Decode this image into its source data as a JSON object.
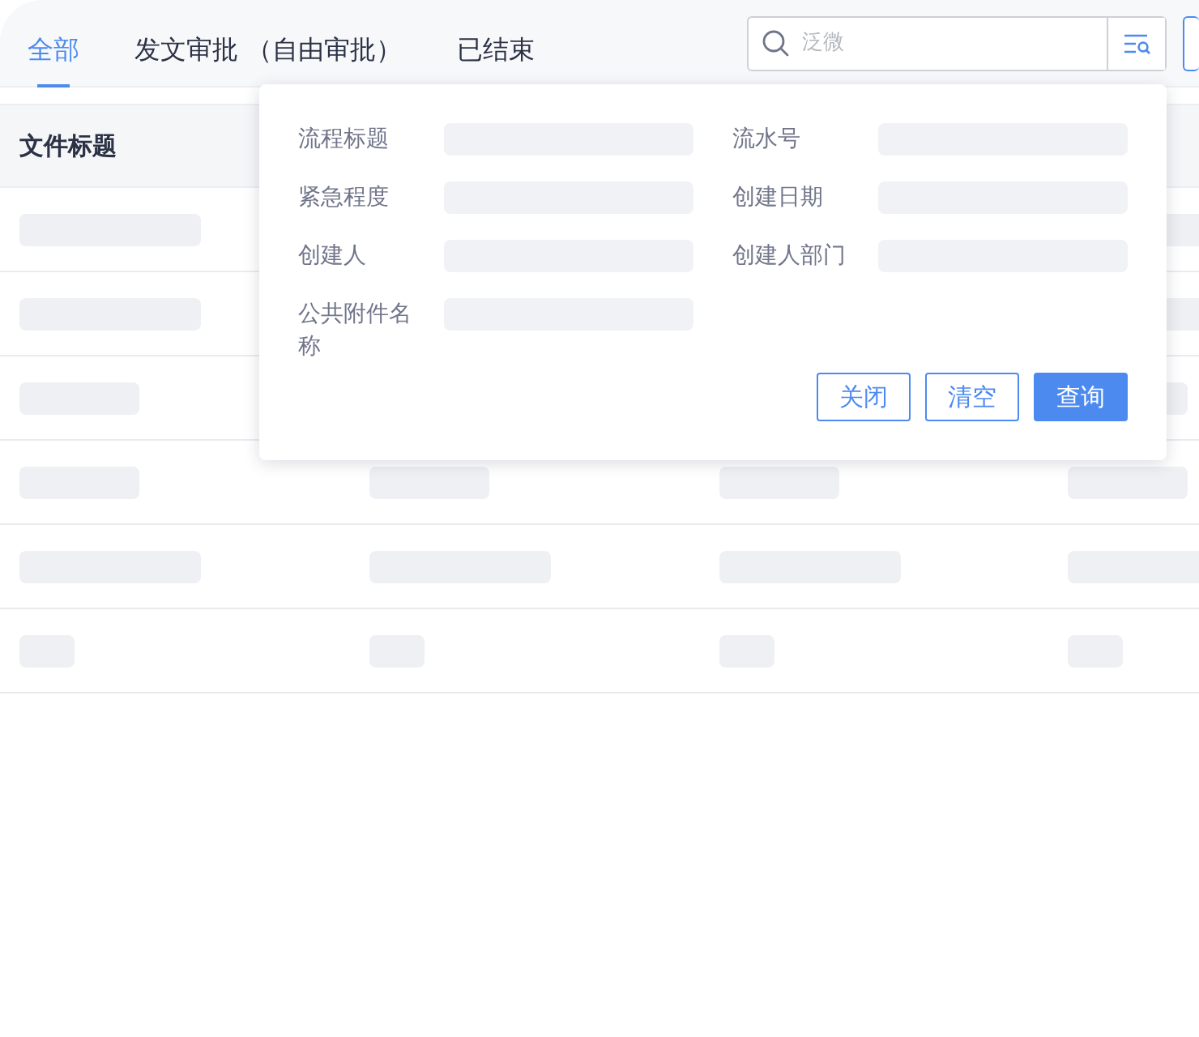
{
  "tabs": [
    {
      "label": "全部",
      "selected": true
    },
    {
      "label": "发文审批 （自由审批）",
      "selected": false
    },
    {
      "label": "已结束",
      "selected": false
    }
  ],
  "search": {
    "placeholder": "泛微"
  },
  "table": {
    "columns": [
      "文件标题"
    ],
    "rows": [
      {
        "kind": "long"
      },
      {
        "kind": "long"
      },
      {
        "kind": "medium"
      },
      {
        "kind": "medium"
      },
      {
        "kind": "long"
      },
      {
        "kind": "short"
      }
    ]
  },
  "filter_panel": {
    "fields": [
      {
        "label": "流程标题"
      },
      {
        "label": "流水号"
      },
      {
        "label": "紧急程度"
      },
      {
        "label": "创建日期"
      },
      {
        "label": "创建人"
      },
      {
        "label": "创建人部门"
      },
      {
        "label": "公共附件名称"
      }
    ],
    "buttons": [
      {
        "label": "关闭",
        "kind": "outline"
      },
      {
        "label": "清空",
        "kind": "outline"
      },
      {
        "label": "查询",
        "kind": "primary"
      }
    ]
  }
}
